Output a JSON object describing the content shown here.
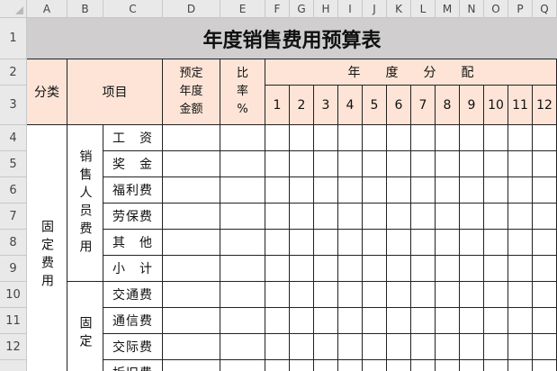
{
  "columns": [
    "A",
    "B",
    "C",
    "D",
    "E",
    "F",
    "G",
    "H",
    "I",
    "J",
    "K",
    "L",
    "M",
    "N",
    "O",
    "P",
    "Q"
  ],
  "rows": [
    "1",
    "2",
    "3",
    "4",
    "5",
    "6",
    "7",
    "8",
    "9",
    "10",
    "11",
    "12"
  ],
  "title": "年度销售费用预算表",
  "headers": {
    "category": "分类",
    "item": "项目",
    "budget_line1": "预定",
    "budget_line2": "年度",
    "budget_line3": "金额",
    "ratio_line1": "比",
    "ratio_line2": "率",
    "ratio_line3": "%",
    "annual_alloc": "年　　度　　分　　配",
    "months": [
      "1",
      "2",
      "3",
      "4",
      "5",
      "6",
      "7",
      "8",
      "9",
      "10",
      "11",
      "12"
    ]
  },
  "groups": {
    "fixed_cost": "固定费用",
    "sales_staff_cost": "销售人员费用",
    "fixed_sub": "固定"
  },
  "items": [
    "工　资",
    "奖　金",
    "福利费",
    "劳保费",
    "其　他",
    "小　计",
    "交通费",
    "通信费",
    "交际费",
    "折旧费"
  ]
}
